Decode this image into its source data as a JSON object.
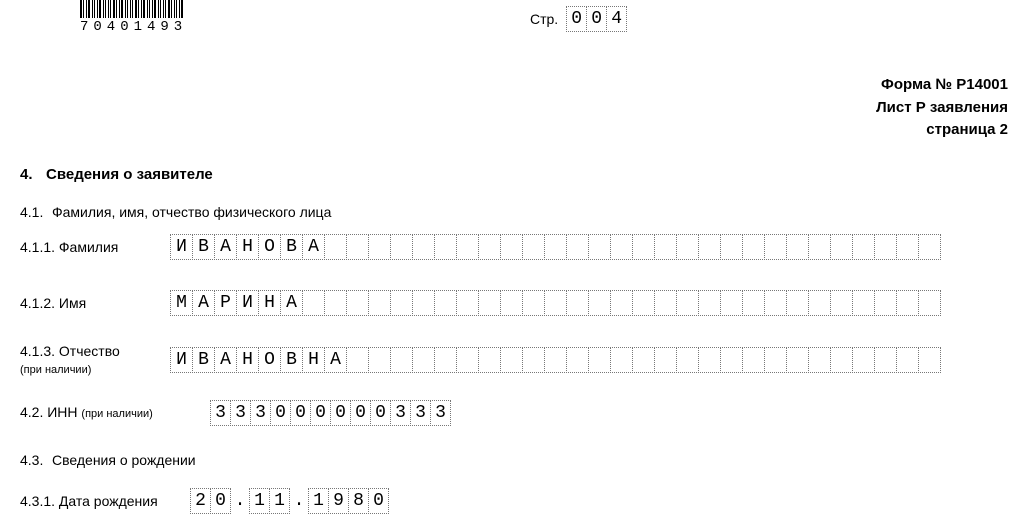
{
  "barcode_number": "70401493",
  "page_label": "Стр.",
  "page_cells": [
    "0",
    "0",
    "4"
  ],
  "top_right": {
    "form": "Форма № Р14001",
    "sheet": "Лист Р заявления",
    "page": "страница 2"
  },
  "s4": {
    "num": "4.",
    "title": "Сведения о заявителе"
  },
  "s41": {
    "num": "4.1.",
    "title": "Фамилия, имя, отчество физического лица"
  },
  "r411": {
    "label": "4.1.1. Фамилия",
    "cells": [
      "И",
      "В",
      "А",
      "Н",
      "О",
      "В",
      "А",
      "",
      "",
      "",
      "",
      "",
      "",
      "",
      "",
      "",
      "",
      "",
      "",
      "",
      "",
      "",
      "",
      "",
      "",
      "",
      "",
      "",
      "",
      "",
      "",
      "",
      "",
      "",
      ""
    ]
  },
  "r412": {
    "label": "4.1.2. Имя",
    "cells": [
      "М",
      "А",
      "Р",
      "И",
      "Н",
      "А",
      "",
      "",
      "",
      "",
      "",
      "",
      "",
      "",
      "",
      "",
      "",
      "",
      "",
      "",
      "",
      "",
      "",
      "",
      "",
      "",
      "",
      "",
      "",
      "",
      "",
      "",
      "",
      "",
      ""
    ]
  },
  "r413": {
    "label": "4.1.3. Отчество",
    "sub": "(при наличии)",
    "cells": [
      "И",
      "В",
      "А",
      "Н",
      "О",
      "В",
      "Н",
      "А",
      "",
      "",
      "",
      "",
      "",
      "",
      "",
      "",
      "",
      "",
      "",
      "",
      "",
      "",
      "",
      "",
      "",
      "",
      "",
      "",
      "",
      "",
      "",
      "",
      "",
      "",
      ""
    ]
  },
  "r42": {
    "label": "4.2. ИНН ",
    "sub": "(при наличии)",
    "cells": [
      "3",
      "3",
      "3",
      "0",
      "0",
      "0",
      "0",
      "0",
      "0",
      "3",
      "3",
      "3"
    ]
  },
  "s43": {
    "num": "4.3.",
    "title": "Сведения о рождении"
  },
  "r431": {
    "label": "4.3.1. Дата рождения",
    "groups": [
      [
        "2",
        "0"
      ],
      [
        "1",
        "1"
      ],
      [
        "1",
        "9",
        "8",
        "0"
      ]
    ],
    "sep": "."
  }
}
